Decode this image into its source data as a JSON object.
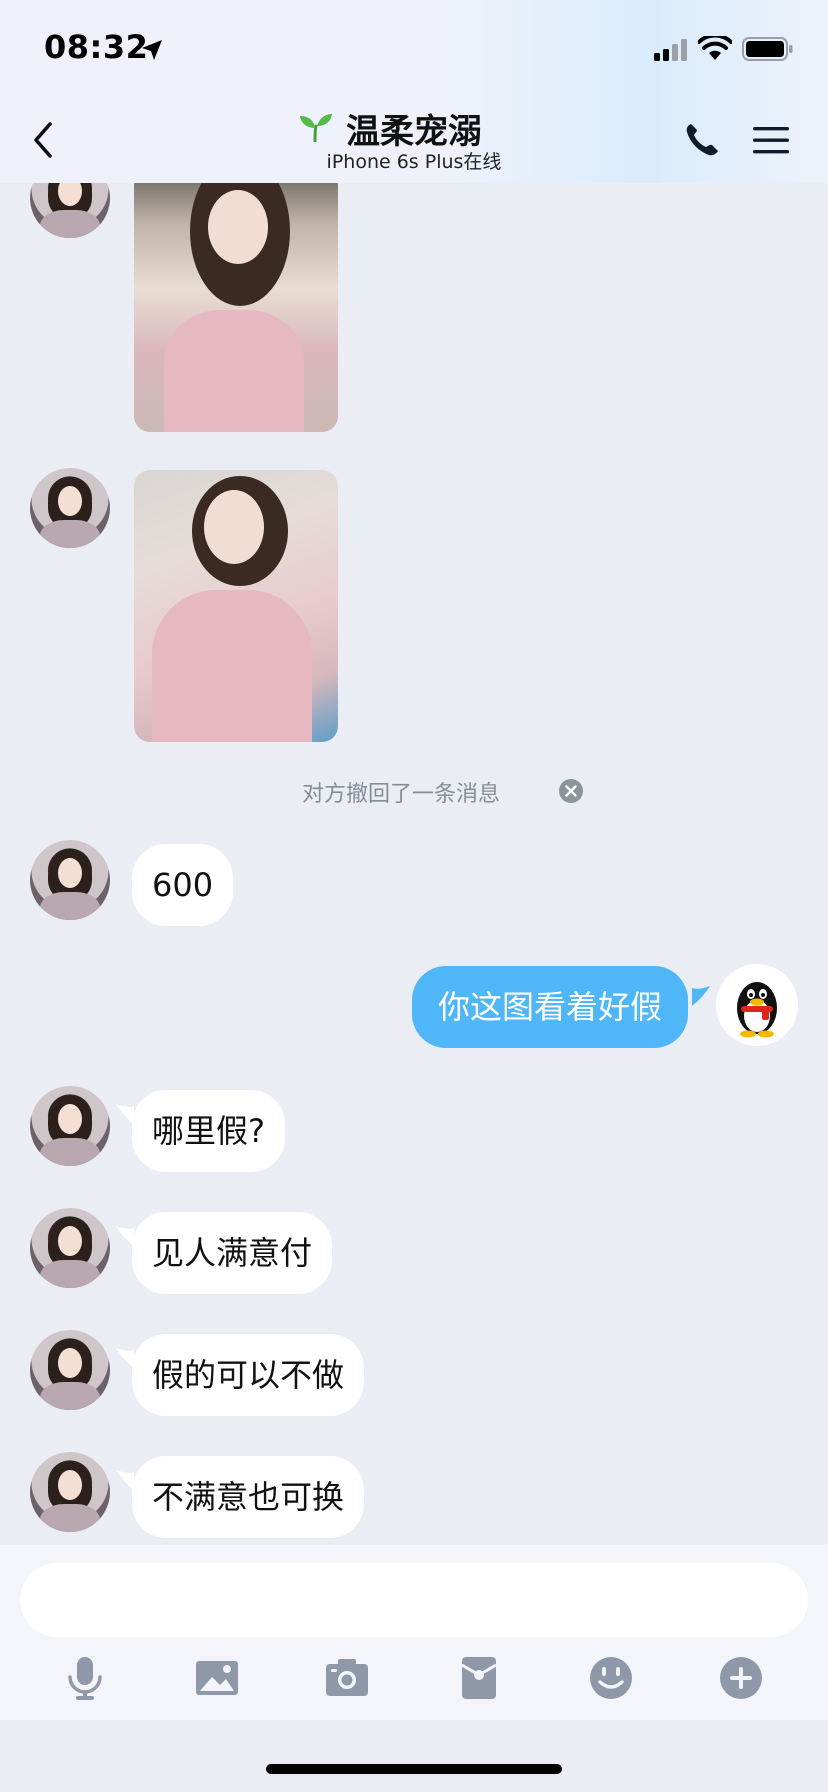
{
  "status_bar": {
    "time": "08:32"
  },
  "header": {
    "title": "温柔宠溺",
    "subtitle": "iPhone 6s Plus在线"
  },
  "chat": {
    "recall_notice": "对方撤回了一条消息",
    "messages": [
      {
        "sender": "contact",
        "text": "600"
      },
      {
        "sender": "me",
        "text": "你这图看着好假"
      },
      {
        "sender": "contact",
        "text": "哪里假?"
      },
      {
        "sender": "contact",
        "text": "见人满意付"
      },
      {
        "sender": "contact",
        "text": "假的可以不做"
      },
      {
        "sender": "contact",
        "text": "不满意也可换"
      }
    ]
  },
  "input": {
    "placeholder": "",
    "value": ""
  },
  "toolbar": {
    "icons": [
      "microphone-icon",
      "image-icon",
      "camera-icon",
      "red-packet-icon",
      "emoji-icon",
      "plus-icon"
    ]
  },
  "colors": {
    "background": "#eaedf4",
    "my_bubble": "#4fb6f7",
    "their_bubble": "#ffffff",
    "toolbar_icon": "#8f98a8"
  }
}
